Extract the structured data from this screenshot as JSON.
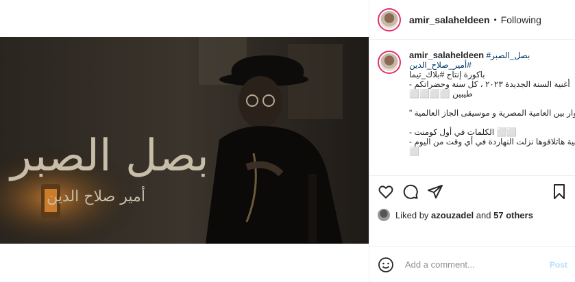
{
  "post": {
    "username": "amir_salaheldeen",
    "follow_status": "Following",
    "separator": "•"
  },
  "media": {
    "overlay_title": "بصل الصبر",
    "overlay_artist": "أمير صلاح الدين"
  },
  "caption": {
    "username": "amir_salaheldeen",
    "lines": [
      "#بصل_الصبر",
      "#أمير_صلاح_الدين",
      "باكورة إنتاج #بلاك_تيما",
      "أغنية السنة الجديدة ٢٠٢٣ ، كل سنة وحضراتكم -",
      "طيبين ⬜⬜⬜⬜",
      "",
      "\" حوار بين العامية المصرية و موسيقى الجاز العالمية \"",
      "",
      "⬜⬜ الكلمات في أول كومنت -",
      "الأغنية هاتلاقوها نزلت النهاردة في أي وقت من اليوم -",
      "⬜"
    ]
  },
  "likes": {
    "prefix": "Liked by",
    "liker": "azouzadel",
    "middle": "and",
    "others": "57 others"
  },
  "timestamp": "",
  "comment_box": {
    "placeholder": "Add a comment...",
    "post_label": "Post"
  },
  "colors": {
    "accent_link": "#00376b",
    "post_button": "#b2dffc",
    "divider": "#efefef"
  }
}
